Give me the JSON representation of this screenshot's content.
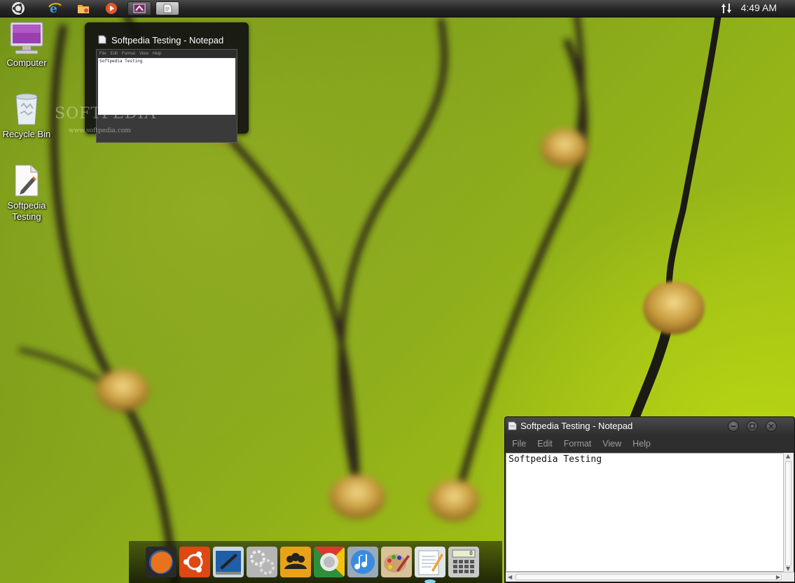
{
  "topbar": {
    "clock": "4:49 AM",
    "launchers": [
      {
        "name": "ubuntu-logo-icon"
      },
      {
        "name": "internet-explorer-icon"
      },
      {
        "name": "folder-icon"
      },
      {
        "name": "media-player-icon"
      }
    ],
    "tasks": [
      {
        "name": "paint-task-icon",
        "active": false
      },
      {
        "name": "notepad-task-icon",
        "active": true
      }
    ],
    "network_icon": "network-updown-icon"
  },
  "desktop": {
    "icons": [
      {
        "label": "Computer",
        "icon": "computer-icon"
      },
      {
        "label": "Recycle Bin",
        "icon": "recycle-bin-icon"
      },
      {
        "label": "Softpedia Testing",
        "icon": "text-document-icon"
      }
    ]
  },
  "preview": {
    "title": "Softpedia Testing - Notepad",
    "menu": [
      "File",
      "Edit",
      "Format",
      "View",
      "Help"
    ],
    "content": "Softpedia Testing",
    "watermark": "SOFTPEDIA",
    "watermark_tm": "™",
    "watermark_url": "www.softpedia.com"
  },
  "notepad": {
    "title": "Softpedia Testing - Notepad",
    "menu": [
      "File",
      "Edit",
      "Format",
      "View",
      "Help"
    ],
    "content": "Softpedia Testing"
  },
  "dock": {
    "items": [
      {
        "name": "firefox-icon",
        "color": "#e8731c"
      },
      {
        "name": "ubuntu-icon",
        "color": "#dd4814"
      },
      {
        "name": "drawing-app-icon",
        "color": "#2a6cb2"
      },
      {
        "name": "settings-gears-icon",
        "color": "#b5b5b5"
      },
      {
        "name": "contacts-icon",
        "color": "#e8a21a"
      },
      {
        "name": "chrome-icon",
        "color": "#dddddd"
      },
      {
        "name": "itunes-icon",
        "color": "#3a8ae0"
      },
      {
        "name": "paint-brush-icon",
        "color": "#caa070"
      },
      {
        "name": "notepad-app-icon",
        "color": "#f4f4f4"
      },
      {
        "name": "calculator-icon",
        "color": "#c9c9c9"
      }
    ],
    "calculator_display": "0"
  }
}
